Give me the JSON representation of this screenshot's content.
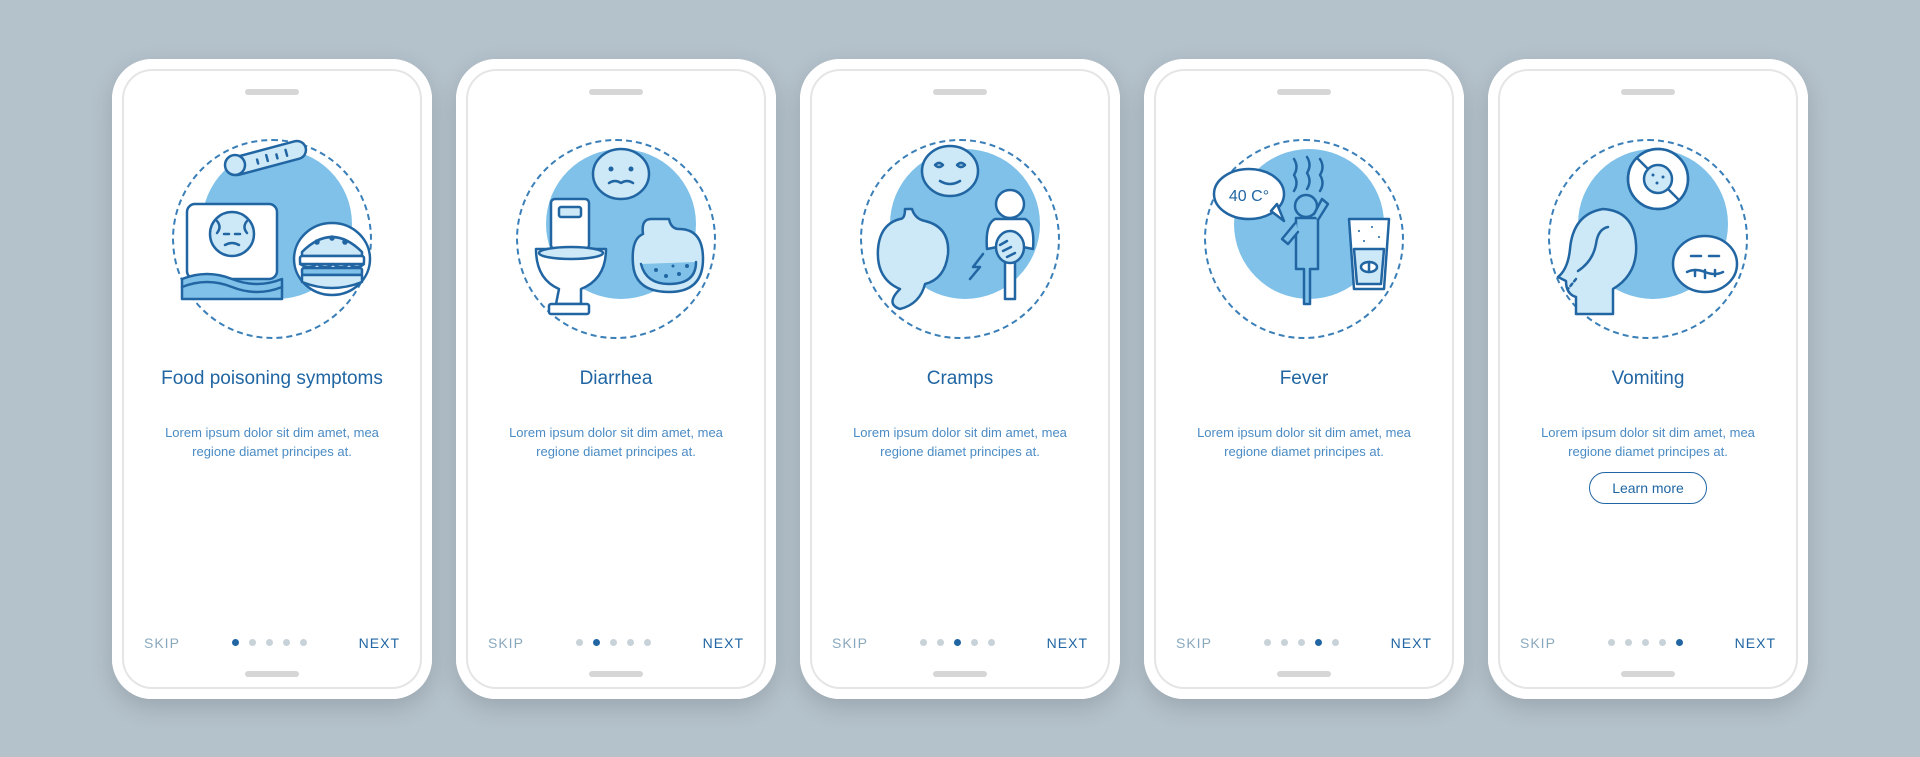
{
  "common": {
    "skip": "SKIP",
    "next": "NEXT",
    "learn_more": "Learn more",
    "description": "Lorem ipsum dolor sit dim amet, mea regione diamet principes at."
  },
  "screens": [
    {
      "title": "Food poisoning symptoms",
      "active_dot": 0,
      "icon": "sick-bed-burger",
      "has_learn_more": false
    },
    {
      "title": "Diarrhea",
      "active_dot": 1,
      "icon": "toilet-stomach",
      "has_learn_more": false
    },
    {
      "title": "Cramps",
      "active_dot": 2,
      "icon": "stomach-pain",
      "has_learn_more": false
    },
    {
      "title": "Fever",
      "active_dot": 3,
      "icon": "fever-temp",
      "has_learn_more": false
    },
    {
      "title": "Vomiting",
      "active_dot": 4,
      "icon": "vomit-no-food",
      "has_learn_more": true
    }
  ],
  "colors": {
    "accent": "#2166a3",
    "light": "#7fc1e8",
    "muted": "#8aa8bd",
    "bg": "#b4c2cc"
  },
  "fever_label": "40 C°"
}
